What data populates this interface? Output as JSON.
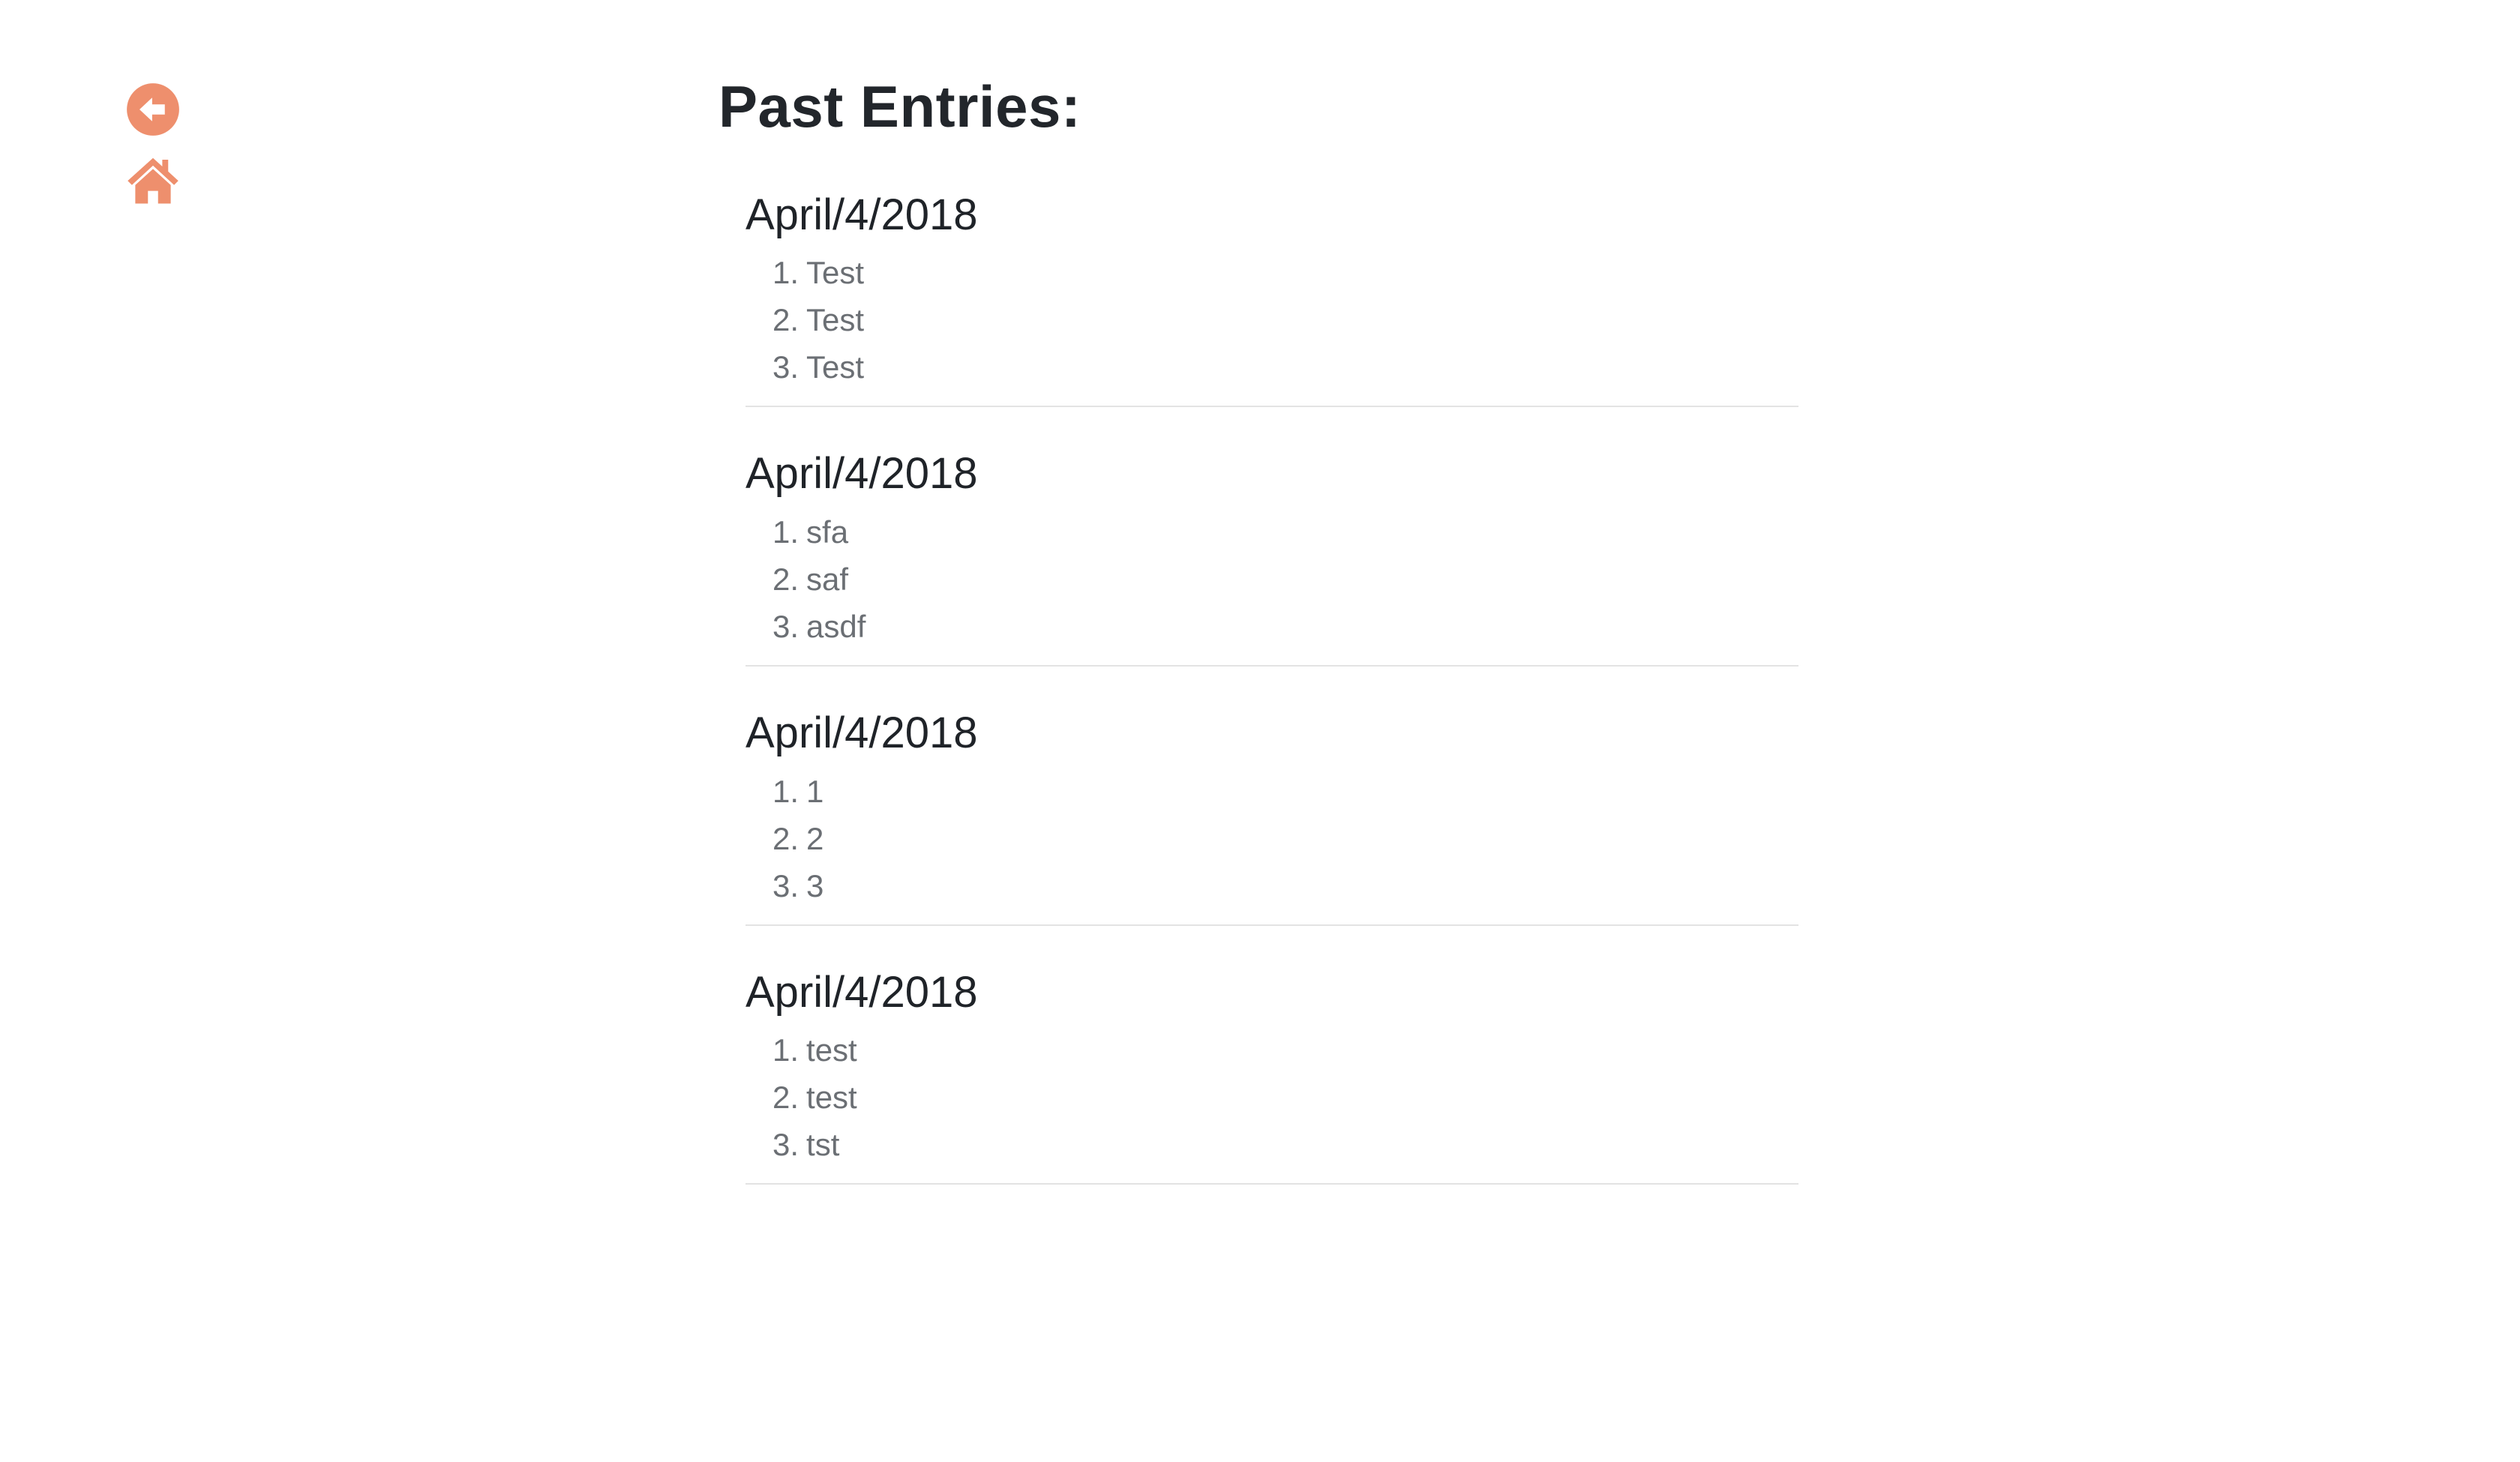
{
  "nav": {
    "accent_color": "#ee8f6d",
    "back_icon": "arrow-circle-left-icon",
    "home_icon": "home-icon"
  },
  "page": {
    "title": "Past Entries:"
  },
  "entries": [
    {
      "date": "April/4/2018",
      "items": [
        {
          "num": "1.",
          "text": "Test"
        },
        {
          "num": "2.",
          "text": "Test"
        },
        {
          "num": "3.",
          "text": "Test"
        }
      ]
    },
    {
      "date": "April/4/2018",
      "items": [
        {
          "num": "1.",
          "text": "sfa"
        },
        {
          "num": "2.",
          "text": "saf"
        },
        {
          "num": "3.",
          "text": "asdf"
        }
      ]
    },
    {
      "date": "April/4/2018",
      "items": [
        {
          "num": "1.",
          "text": "1"
        },
        {
          "num": "2.",
          "text": "2"
        },
        {
          "num": "3.",
          "text": "3"
        }
      ]
    },
    {
      "date": "April/4/2018",
      "items": [
        {
          "num": "1.",
          "text": "test"
        },
        {
          "num": "2.",
          "text": "test"
        },
        {
          "num": "3.",
          "text": "tst"
        }
      ]
    }
  ]
}
